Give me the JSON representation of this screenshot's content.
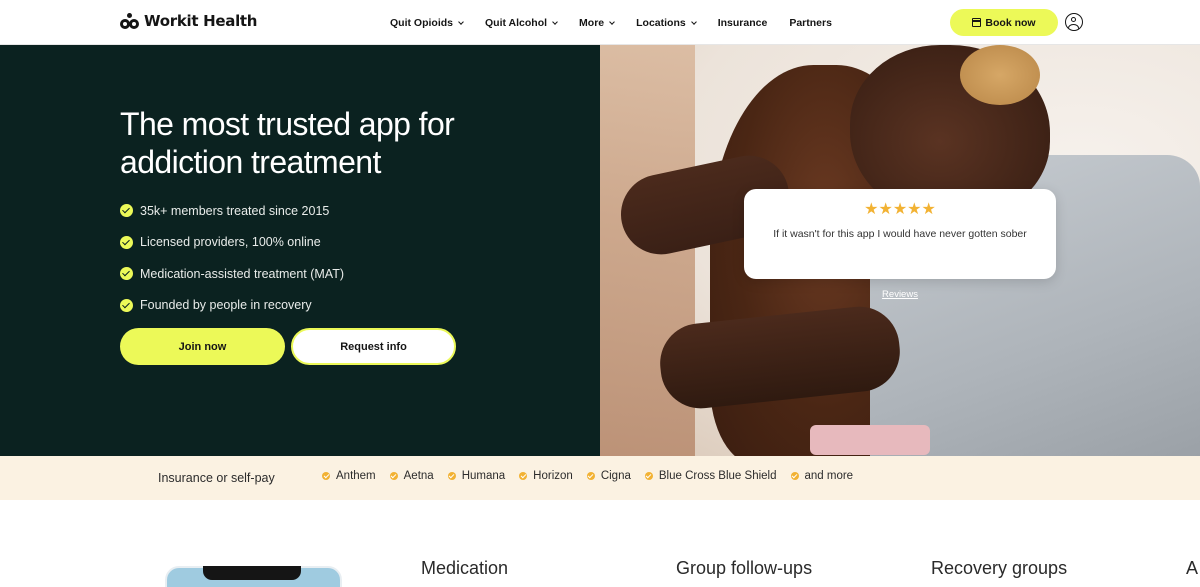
{
  "brand": {
    "name": "Workit Health"
  },
  "nav": {
    "items": [
      {
        "label": "Quit Opioids",
        "dropdown": true
      },
      {
        "label": "Quit Alcohol",
        "dropdown": true
      },
      {
        "label": "More",
        "dropdown": true
      },
      {
        "label": "Locations",
        "dropdown": true
      },
      {
        "label": "Insurance",
        "dropdown": false
      },
      {
        "label": "Partners",
        "dropdown": false
      }
    ],
    "book_label": "Book now"
  },
  "hero": {
    "title_line1": "The most trusted app for",
    "title_line2": "addiction treatment",
    "bullets": [
      "35k+ members treated since 2015",
      "Licensed providers, 100% online",
      "Medication-assisted treatment (MAT)",
      "Founded by people in recovery"
    ],
    "join_label": "Join now",
    "info_label": "Request info"
  },
  "review": {
    "rating": 5,
    "stars": "★★★★★",
    "quote": "If it wasn't for this app I would have never gotten sober",
    "link_label": "Reviews"
  },
  "insurance": {
    "label": "Insurance or self-pay",
    "providers": [
      "Anthem",
      "Aetna",
      "Humana",
      "Horizon",
      "Cigna",
      "Blue Cross Blue Shield",
      "and more"
    ]
  },
  "features": {
    "items": [
      "Medication",
      "Group follow-ups",
      "Recovery groups",
      "A"
    ]
  },
  "colors": {
    "accent": "#ecf958",
    "hero_bg": "#0b2220",
    "strip_bg": "#fbf2e2",
    "star": "#f2b233"
  }
}
